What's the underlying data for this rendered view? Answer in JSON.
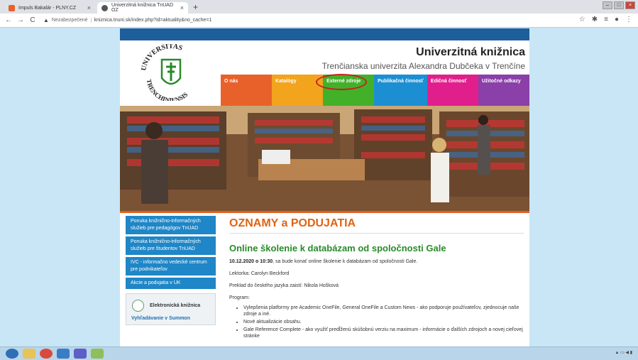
{
  "browser": {
    "tabs": [
      {
        "label": "Impuls Bakalár - PLNY.CZ",
        "icon": "orange-favicon"
      },
      {
        "label": "Univerzitná knižnica TnUAD OZ",
        "icon": "globe-favicon"
      }
    ],
    "address": {
      "security": "Nezabezpečené",
      "url": "kniznica.tnuni.sk/index.php?id=aktuality&no_cache=1"
    }
  },
  "site": {
    "title": "Univerzitná knižnica",
    "subtitle": "Trenčianska univerzita Alexandra Dubčeka v Trenčíne",
    "logo_text": "UNIVERSITAS TRENCHINIENSIS",
    "menu": [
      {
        "label": "O nás",
        "color": "#e9612a"
      },
      {
        "label": "Katalógy",
        "color": "#f2a41d"
      },
      {
        "label": "Externé zdroje",
        "color": "#43b02a"
      },
      {
        "label": "Publikačná činnosť",
        "color": "#1c8fd3"
      },
      {
        "label": "Edičná činnosť",
        "color": "#e11f8c"
      },
      {
        "label": "Užitočné odkazy",
        "color": "#8b3fa8"
      }
    ],
    "sidebar": [
      "Ponuka knižnično-informačných služieb pre pedagógov TnUAD",
      "Ponuka knižnično-informačných služieb pre študentov TnUAD",
      "IVC - informačno vedecké centrum pre podnikateľov",
      "Akcie a podujatia v UK"
    ],
    "ebox": {
      "title": "Elektronická knižnica",
      "link": "Vyhľadávanie v Summon"
    },
    "content": {
      "heading": "OZNAMY a PODUJATIA",
      "article_title": "Online školenie k databázam od spoločnosti Gale",
      "date": "10.12.2020 o 10:30",
      "intro": ", sa bude konať online školenie k databázam od spoločnosti Gale.",
      "lecturer": "Lektorka: Carolyn Beckford",
      "translation": "Preklad do českého jazyka zaistí: Nikola Hošková",
      "program_label": "Program:",
      "program": [
        "Vylepšenia platformy pre Academic OneFile, General OneFile a Custom News - ako podporuje používateľov, zjednocuje naše zdroje a iné.",
        "Nové aktualizácie obsahu.",
        "Gale Reference Complete - ako využiť predĺženú skúšobnú verziu na maximum - informácie o ďalších zdrojoch a novej cieľovej stránke"
      ]
    }
  },
  "colors": {
    "topbar": "#1e5e9b",
    "sidebar_button": "#1f86c7",
    "heading": "#e06310",
    "article": "#2a8a2a",
    "circle": "#c7211d"
  }
}
